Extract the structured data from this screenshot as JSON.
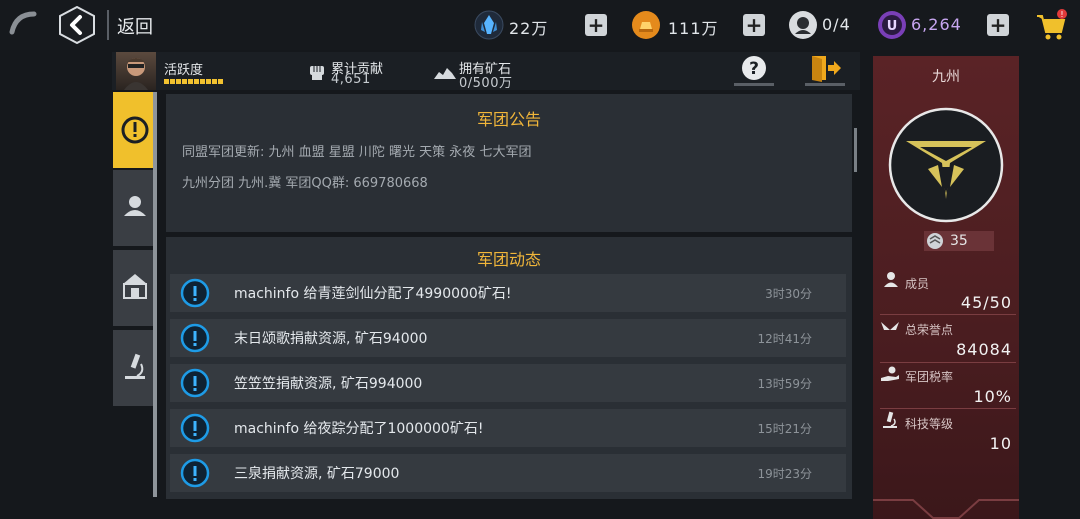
{
  "topbar": {
    "back_label": "返回",
    "crystal": "22万",
    "gold": "111万",
    "stamina": "0/4",
    "u_coin": "6,264"
  },
  "header": {
    "activity_label": "活跃度",
    "contribution_label": "累计贡献",
    "contribution_value": "4,651",
    "ore_label": "拥有矿石",
    "ore_value": "0/500万"
  },
  "announcement": {
    "title": "军团公告",
    "line1": "同盟军团更新: 九州 血盟 星盟 川陀 曙光 天策 永夜 七大军团",
    "line2": "九州分团 九州.冀     军团QQ群: 669780668"
  },
  "news": {
    "title": "军团动态",
    "items": [
      {
        "text": "machinfo 给青莲剑仙分配了4990000矿石!",
        "time": "3时30分"
      },
      {
        "text": "末日颂歌捐献资源, 矿石94000",
        "time": "12时41分"
      },
      {
        "text": "笠笠笠捐献资源, 矿石994000",
        "time": "13时59分"
      },
      {
        "text": "machinfo 给夜踪分配了1000000矿石!",
        "time": "15时21分"
      },
      {
        "text": "三泉捐献资源, 矿石79000",
        "time": "19时23分"
      }
    ]
  },
  "legion": {
    "name": "九州",
    "level": "35",
    "members_label": "成员",
    "members_value": "45/50",
    "honor_label": "总荣誉点",
    "honor_value": "84084",
    "tax_label": "军团税率",
    "tax_value": "10%",
    "tech_label": "科技等级",
    "tech_value": "10"
  },
  "colors": {
    "accent": "#f0c02c",
    "title": "#f1b63a",
    "side_panel": "#5a2326",
    "alert_icon": "#1e9be6"
  }
}
